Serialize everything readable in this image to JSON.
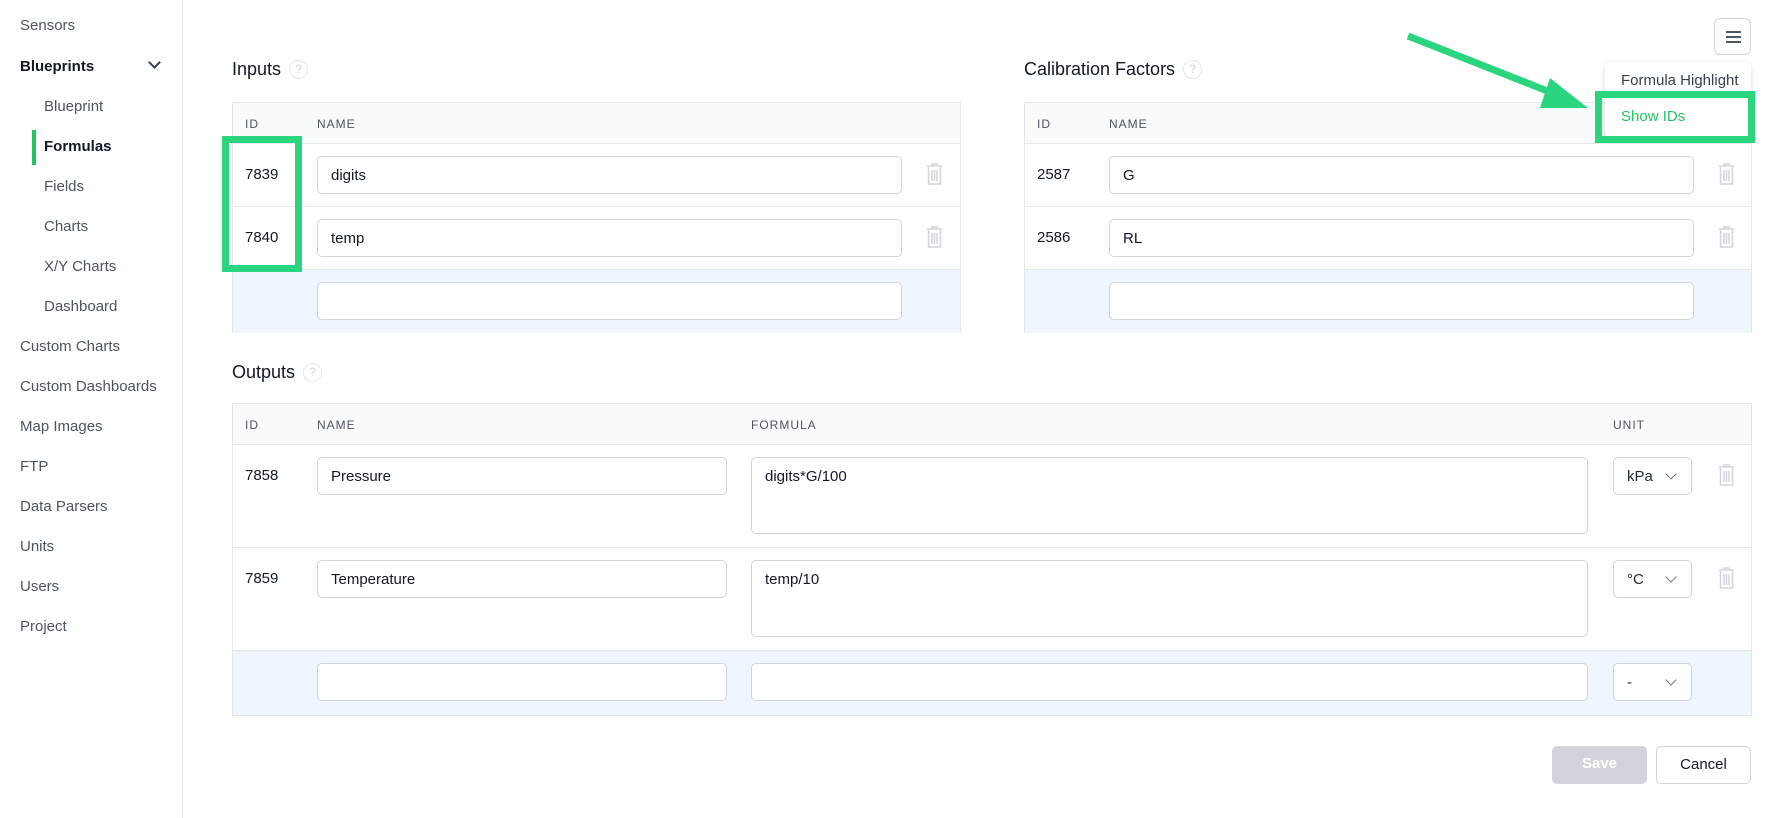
{
  "sidebar": {
    "items": [
      "Sensors",
      "Blueprints",
      "Blueprint",
      "Formulas",
      "Fields",
      "Charts",
      "X/Y Charts",
      "Dashboard",
      "Custom Charts",
      "Custom Dashboards",
      "Map Images",
      "FTP",
      "Data Parsers",
      "Units",
      "Users",
      "Project"
    ],
    "active": "Formulas"
  },
  "inputs": {
    "title": "Inputs",
    "help": "?",
    "headers": [
      "ID",
      "NAME"
    ],
    "rows": [
      {
        "id": "7839",
        "name": "digits"
      },
      {
        "id": "7840",
        "name": "temp"
      }
    ]
  },
  "calibration": {
    "title": "Calibration Factors",
    "help": "?",
    "headers": [
      "ID",
      "NAME"
    ],
    "rows": [
      {
        "id": "2587",
        "name": "G"
      },
      {
        "id": "2586",
        "name": "RL"
      }
    ]
  },
  "outputs": {
    "title": "Outputs",
    "help": "?",
    "headers": [
      "ID",
      "NAME",
      "FORMULA",
      "UNIT"
    ],
    "rows": [
      {
        "id": "7858",
        "name": "Pressure",
        "formula": "digits*G/100",
        "unit": "kPa"
      },
      {
        "id": "7859",
        "name": "Temperature",
        "formula": "temp/10",
        "unit": "°C"
      }
    ],
    "new_unit": "-"
  },
  "menu": {
    "items": [
      "Formula Highlight",
      "Show IDs"
    ]
  },
  "actions": {
    "save": "Save",
    "cancel": "Cancel"
  },
  "colors": {
    "accent": "#22c55e",
    "highlight": "#2bd47e"
  }
}
